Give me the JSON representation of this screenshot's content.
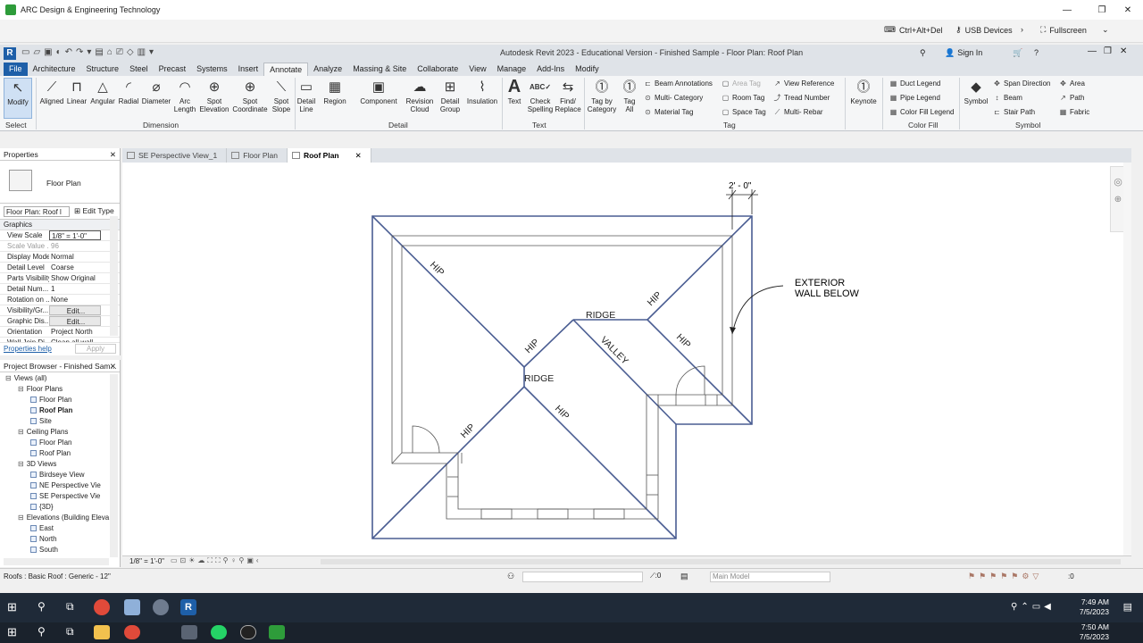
{
  "outer": {
    "title": "ARC Design & Engineering Technology",
    "ctrl_alt_del": "Ctrl+Alt+Del",
    "usb": "USB Devices",
    "fullscreen": "Fullscreen"
  },
  "revit": {
    "title": "Autodesk Revit 2023 - Educational Version - Finished Sample - Floor Plan: Roof Plan",
    "sign_in": "Sign In",
    "tabs": [
      "File",
      "Architecture",
      "Structure",
      "Steel",
      "Precast",
      "Systems",
      "Insert",
      "Annotate",
      "Analyze",
      "Massing & Site",
      "Collaborate",
      "View",
      "Manage",
      "Add-Ins",
      "Modify"
    ],
    "active_tab": "Annotate"
  },
  "ribbon": {
    "modify": "Modify",
    "dimension_tools": [
      "Aligned",
      "Linear",
      "Angular",
      "Radial",
      "Diameter",
      "Arc\nLength",
      "Spot\nElevation",
      "Spot\nCoordinate",
      "Spot\nSlope"
    ],
    "detail_tools": [
      "Detail\nLine",
      "Region",
      "Component",
      "Revision\nCloud",
      "Detail\nGroup",
      "Insulation"
    ],
    "text_tools": [
      "Text",
      "Check\nSpelling",
      "Find/\nReplace"
    ],
    "tag_tools": [
      "Tag by\nCategory",
      "Tag\nAll"
    ],
    "tag_small": [
      "Beam Annotations",
      "Multi- Category",
      "Material Tag",
      "Area Tag",
      "Room Tag",
      "Space Tag",
      "View Reference",
      "Tread Number",
      "Multi- Rebar"
    ],
    "keynote": "Keynote",
    "colorfill_small": [
      "Duct Legend",
      "Pipe Legend",
      "Color Fill Legend"
    ],
    "symbol": "Symbol",
    "symbol_small": [
      "Span Direction",
      "Beam",
      "Stair Path",
      "Area",
      "Path",
      "Fabric"
    ],
    "panels": [
      "Select",
      "Dimension",
      "Detail",
      "Text",
      "Tag",
      "Color Fill",
      "Symbol"
    ]
  },
  "viewtabs": [
    "SE Perspective View_1",
    "Floor Plan",
    "Roof Plan"
  ],
  "properties": {
    "title": "Properties",
    "type": "Floor Plan",
    "selector": "Floor Plan: Roof l",
    "edit_type": "Edit Type",
    "section": "Graphics",
    "rows": [
      {
        "k": "View Scale",
        "v": "1/8\" = 1'-0\""
      },
      {
        "k": "Scale Value ...",
        "v": "96"
      },
      {
        "k": "Display Model",
        "v": "Normal"
      },
      {
        "k": "Detail Level",
        "v": "Coarse"
      },
      {
        "k": "Parts Visibility",
        "v": "Show Original"
      },
      {
        "k": "Detail Num...",
        "v": "1"
      },
      {
        "k": "Rotation on ...",
        "v": "None"
      },
      {
        "k": "Visibility/Gr...",
        "v": "Edit..."
      },
      {
        "k": "Graphic Dis...",
        "v": "Edit..."
      },
      {
        "k": "Orientation",
        "v": "Project North"
      },
      {
        "k": "Wall Join Di...",
        "v": "Clean all wall"
      }
    ],
    "help": "Properties help",
    "apply": "Apply"
  },
  "browser": {
    "title": "Project Browser - Finished Sam...",
    "items": [
      {
        "label": "Views (all)",
        "lvl": 0
      },
      {
        "label": "Floor Plans",
        "lvl": 1
      },
      {
        "label": "Floor Plan",
        "lvl": 2
      },
      {
        "label": "Roof Plan",
        "lvl": 2,
        "bold": true
      },
      {
        "label": "Site",
        "lvl": 2
      },
      {
        "label": "Ceiling Plans",
        "lvl": 1
      },
      {
        "label": "Floor Plan",
        "lvl": 2
      },
      {
        "label": "Roof Plan",
        "lvl": 2
      },
      {
        "label": "3D Views",
        "lvl": 1
      },
      {
        "label": "Birdseye View",
        "lvl": 2
      },
      {
        "label": "NE Perspective Vie",
        "lvl": 2
      },
      {
        "label": "SE Perspective Vie",
        "lvl": 2
      },
      {
        "label": "{3D}",
        "lvl": 2
      },
      {
        "label": "Elevations (Building Eleva",
        "lvl": 1
      },
      {
        "label": "East",
        "lvl": 2
      },
      {
        "label": "North",
        "lvl": 2
      },
      {
        "label": "South",
        "lvl": 2
      }
    ]
  },
  "drawing": {
    "dim": "2' - 0\"",
    "note": [
      "EXTERIOR",
      "WALL BELOW"
    ],
    "labels": [
      "HIP",
      "HIP",
      "HIP",
      "HIP",
      "HIP",
      "HIP",
      "RIDGE",
      "RIDGE",
      "VALLEY"
    ]
  },
  "viewcontrol": {
    "scale": "1/8\" = 1'-0\""
  },
  "status": {
    "left": "Roofs : Basic Roof : Generic - 12\"",
    "zero1": ":0",
    "model": "Main Model",
    "zero2": ":0"
  },
  "taskbar1": {
    "time": "7:49 AM",
    "date": "7/5/2023"
  },
  "taskbar2": {
    "time": "7:50 AM",
    "date": "7/5/2023"
  }
}
